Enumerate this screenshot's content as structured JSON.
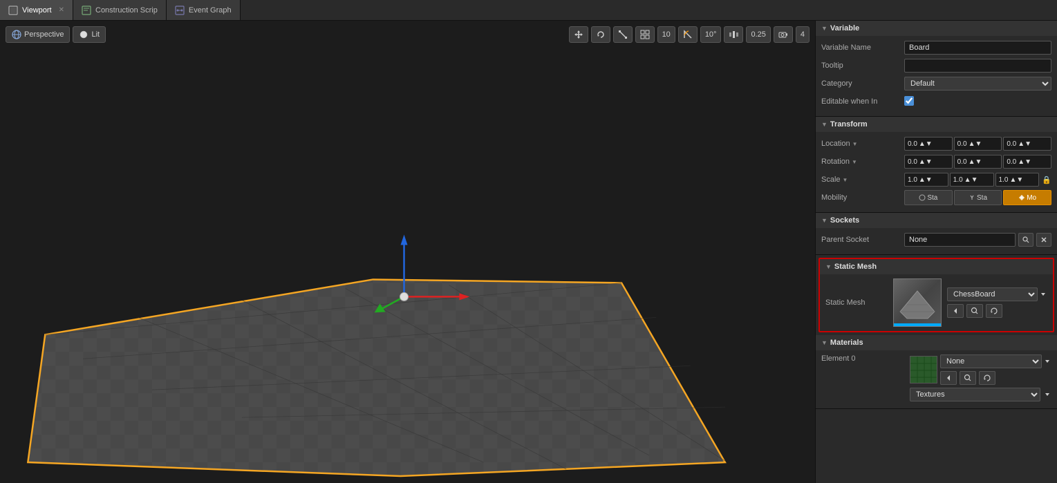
{
  "tabs": [
    {
      "id": "viewport",
      "label": "Viewport",
      "icon": "viewport-icon",
      "active": true,
      "closeable": true
    },
    {
      "id": "construction",
      "label": "Construction Scrip",
      "icon": "script-icon",
      "active": false,
      "closeable": false
    },
    {
      "id": "eventgraph",
      "label": "Event Graph",
      "icon": "graph-icon",
      "active": false,
      "closeable": false
    }
  ],
  "viewport": {
    "perspective_label": "Perspective",
    "lit_label": "Lit"
  },
  "toolbar": {
    "btn10_label": "10",
    "btn10deg_label": "10°",
    "btn025_label": "0.25",
    "btn4_label": "4"
  },
  "panels": {
    "variable": {
      "header": "Variable",
      "variable_name_label": "Variable Name",
      "variable_name_value": "Board",
      "tooltip_label": "Tooltip",
      "tooltip_value": "",
      "category_label": "Category",
      "category_value": "Default",
      "editable_label": "Editable when In",
      "editable_checked": true
    },
    "transform": {
      "header": "Transform",
      "location_label": "Location",
      "rotation_label": "Rotation",
      "scale_label": "Scale",
      "mobility_label": "Mobility",
      "location_x": "0.0",
      "location_y": "0.0",
      "location_z": "0.0",
      "rotation_x": "0.0",
      "rotation_y": "0.0",
      "rotation_z": "0.0",
      "scale_x": "1.0",
      "scale_y": "1.0",
      "scale_z": "1.0",
      "mobility_static_label": "Sta",
      "mobility_stationary_label": "Sta",
      "mobility_movable_label": "Mo"
    },
    "sockets": {
      "header": "Sockets",
      "parent_socket_label": "Parent Socket",
      "parent_socket_value": "None"
    },
    "static_mesh": {
      "header": "Static Mesh",
      "static_mesh_label": "Static Mesh",
      "mesh_name": "ChessBoard",
      "highlighted": true
    },
    "materials": {
      "header": "Materials",
      "element0_label": "Element 0",
      "element0_value": "None",
      "material_dropdown": "None",
      "textures_label": "Textures"
    }
  }
}
